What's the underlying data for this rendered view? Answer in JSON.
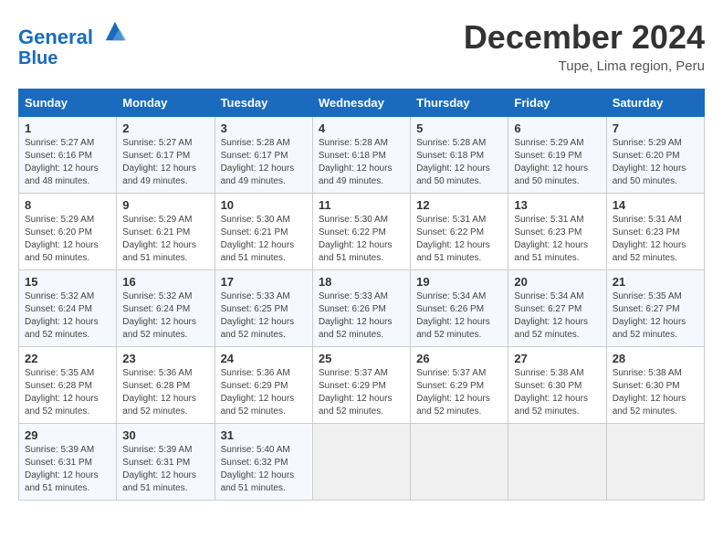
{
  "header": {
    "logo_line1": "General",
    "logo_line2": "Blue",
    "month": "December 2024",
    "location": "Tupe, Lima region, Peru"
  },
  "weekdays": [
    "Sunday",
    "Monday",
    "Tuesday",
    "Wednesday",
    "Thursday",
    "Friday",
    "Saturday"
  ],
  "weeks": [
    [
      {
        "day": "1",
        "info": "Sunrise: 5:27 AM\nSunset: 6:16 PM\nDaylight: 12 hours\nand 48 minutes."
      },
      {
        "day": "2",
        "info": "Sunrise: 5:27 AM\nSunset: 6:17 PM\nDaylight: 12 hours\nand 49 minutes."
      },
      {
        "day": "3",
        "info": "Sunrise: 5:28 AM\nSunset: 6:17 PM\nDaylight: 12 hours\nand 49 minutes."
      },
      {
        "day": "4",
        "info": "Sunrise: 5:28 AM\nSunset: 6:18 PM\nDaylight: 12 hours\nand 49 minutes."
      },
      {
        "day": "5",
        "info": "Sunrise: 5:28 AM\nSunset: 6:18 PM\nDaylight: 12 hours\nand 50 minutes."
      },
      {
        "day": "6",
        "info": "Sunrise: 5:29 AM\nSunset: 6:19 PM\nDaylight: 12 hours\nand 50 minutes."
      },
      {
        "day": "7",
        "info": "Sunrise: 5:29 AM\nSunset: 6:20 PM\nDaylight: 12 hours\nand 50 minutes."
      }
    ],
    [
      {
        "day": "8",
        "info": "Sunrise: 5:29 AM\nSunset: 6:20 PM\nDaylight: 12 hours\nand 50 minutes."
      },
      {
        "day": "9",
        "info": "Sunrise: 5:29 AM\nSunset: 6:21 PM\nDaylight: 12 hours\nand 51 minutes."
      },
      {
        "day": "10",
        "info": "Sunrise: 5:30 AM\nSunset: 6:21 PM\nDaylight: 12 hours\nand 51 minutes."
      },
      {
        "day": "11",
        "info": "Sunrise: 5:30 AM\nSunset: 6:22 PM\nDaylight: 12 hours\nand 51 minutes."
      },
      {
        "day": "12",
        "info": "Sunrise: 5:31 AM\nSunset: 6:22 PM\nDaylight: 12 hours\nand 51 minutes."
      },
      {
        "day": "13",
        "info": "Sunrise: 5:31 AM\nSunset: 6:23 PM\nDaylight: 12 hours\nand 51 minutes."
      },
      {
        "day": "14",
        "info": "Sunrise: 5:31 AM\nSunset: 6:23 PM\nDaylight: 12 hours\nand 52 minutes."
      }
    ],
    [
      {
        "day": "15",
        "info": "Sunrise: 5:32 AM\nSunset: 6:24 PM\nDaylight: 12 hours\nand 52 minutes."
      },
      {
        "day": "16",
        "info": "Sunrise: 5:32 AM\nSunset: 6:24 PM\nDaylight: 12 hours\nand 52 minutes."
      },
      {
        "day": "17",
        "info": "Sunrise: 5:33 AM\nSunset: 6:25 PM\nDaylight: 12 hours\nand 52 minutes."
      },
      {
        "day": "18",
        "info": "Sunrise: 5:33 AM\nSunset: 6:26 PM\nDaylight: 12 hours\nand 52 minutes."
      },
      {
        "day": "19",
        "info": "Sunrise: 5:34 AM\nSunset: 6:26 PM\nDaylight: 12 hours\nand 52 minutes."
      },
      {
        "day": "20",
        "info": "Sunrise: 5:34 AM\nSunset: 6:27 PM\nDaylight: 12 hours\nand 52 minutes."
      },
      {
        "day": "21",
        "info": "Sunrise: 5:35 AM\nSunset: 6:27 PM\nDaylight: 12 hours\nand 52 minutes."
      }
    ],
    [
      {
        "day": "22",
        "info": "Sunrise: 5:35 AM\nSunset: 6:28 PM\nDaylight: 12 hours\nand 52 minutes."
      },
      {
        "day": "23",
        "info": "Sunrise: 5:36 AM\nSunset: 6:28 PM\nDaylight: 12 hours\nand 52 minutes."
      },
      {
        "day": "24",
        "info": "Sunrise: 5:36 AM\nSunset: 6:29 PM\nDaylight: 12 hours\nand 52 minutes."
      },
      {
        "day": "25",
        "info": "Sunrise: 5:37 AM\nSunset: 6:29 PM\nDaylight: 12 hours\nand 52 minutes."
      },
      {
        "day": "26",
        "info": "Sunrise: 5:37 AM\nSunset: 6:29 PM\nDaylight: 12 hours\nand 52 minutes."
      },
      {
        "day": "27",
        "info": "Sunrise: 5:38 AM\nSunset: 6:30 PM\nDaylight: 12 hours\nand 52 minutes."
      },
      {
        "day": "28",
        "info": "Sunrise: 5:38 AM\nSunset: 6:30 PM\nDaylight: 12 hours\nand 52 minutes."
      }
    ],
    [
      {
        "day": "29",
        "info": "Sunrise: 5:39 AM\nSunset: 6:31 PM\nDaylight: 12 hours\nand 51 minutes."
      },
      {
        "day": "30",
        "info": "Sunrise: 5:39 AM\nSunset: 6:31 PM\nDaylight: 12 hours\nand 51 minutes."
      },
      {
        "day": "31",
        "info": "Sunrise: 5:40 AM\nSunset: 6:32 PM\nDaylight: 12 hours\nand 51 minutes."
      },
      null,
      null,
      null,
      null
    ]
  ]
}
